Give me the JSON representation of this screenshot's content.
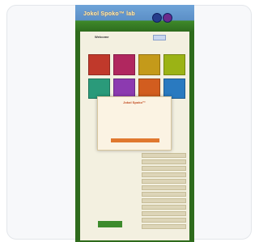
{
  "site": {
    "title": "Jokol Spoko™ lab",
    "colors": {
      "frame": "#2e6b1c",
      "accent": "#e0782f",
      "modal_title": "#c0481d"
    }
  },
  "header": {
    "title": "Welcome",
    "subtitle": "",
    "stat": ""
  },
  "tiles": [
    {
      "label": "",
      "color": "#c0392b"
    },
    {
      "label": "",
      "color": "#b0275f"
    },
    {
      "label": "",
      "color": "#c49a1a"
    },
    {
      "label": "",
      "color": "#9bb315"
    },
    {
      "label": "",
      "color": "#2a9a7a"
    },
    {
      "label": "",
      "color": "#8c3ab0"
    },
    {
      "label": "",
      "color": "#d25d1f"
    },
    {
      "label": "",
      "color": "#2a7ac0"
    }
  ],
  "modal": {
    "title": "Jokol Spoko™",
    "subtitle": "",
    "body": "",
    "button": "",
    "link": "",
    "link2": ""
  },
  "bottom": {
    "button": ""
  }
}
